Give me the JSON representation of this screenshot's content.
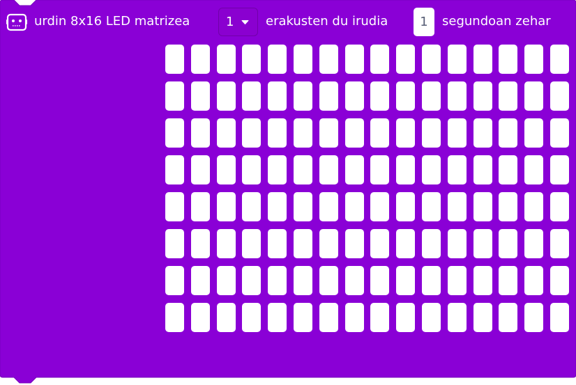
{
  "block": {
    "color": "#8a00d6",
    "border_color": "#7700bd",
    "icon": "microbit-robot-icon",
    "label_prefix": "urdin 8x16 LED matrizea",
    "dropdown_value": "1",
    "label_middle": "erakusten du irudia",
    "duration_value": "1",
    "label_suffix": "segundoan zehar"
  },
  "led_matrix": {
    "rows": 8,
    "cols": 16,
    "led_color": "#ffffff",
    "states": [
      [
        0,
        0,
        0,
        0,
        0,
        0,
        0,
        0,
        0,
        0,
        0,
        0,
        0,
        0,
        0,
        0
      ],
      [
        0,
        0,
        0,
        0,
        0,
        0,
        0,
        0,
        0,
        0,
        0,
        0,
        0,
        0,
        0,
        0
      ],
      [
        0,
        0,
        0,
        0,
        0,
        0,
        0,
        0,
        0,
        0,
        0,
        0,
        0,
        0,
        0,
        0
      ],
      [
        0,
        0,
        0,
        0,
        0,
        0,
        0,
        0,
        0,
        0,
        0,
        0,
        0,
        0,
        0,
        0
      ],
      [
        0,
        0,
        0,
        0,
        0,
        0,
        0,
        0,
        0,
        0,
        0,
        0,
        0,
        0,
        0,
        0
      ],
      [
        0,
        0,
        0,
        0,
        0,
        0,
        0,
        0,
        0,
        0,
        0,
        0,
        0,
        0,
        0,
        0
      ],
      [
        0,
        0,
        0,
        0,
        0,
        0,
        0,
        0,
        0,
        0,
        0,
        0,
        0,
        0,
        0,
        0
      ],
      [
        0,
        0,
        0,
        0,
        0,
        0,
        0,
        0,
        0,
        0,
        0,
        0,
        0,
        0,
        0,
        0
      ]
    ]
  }
}
